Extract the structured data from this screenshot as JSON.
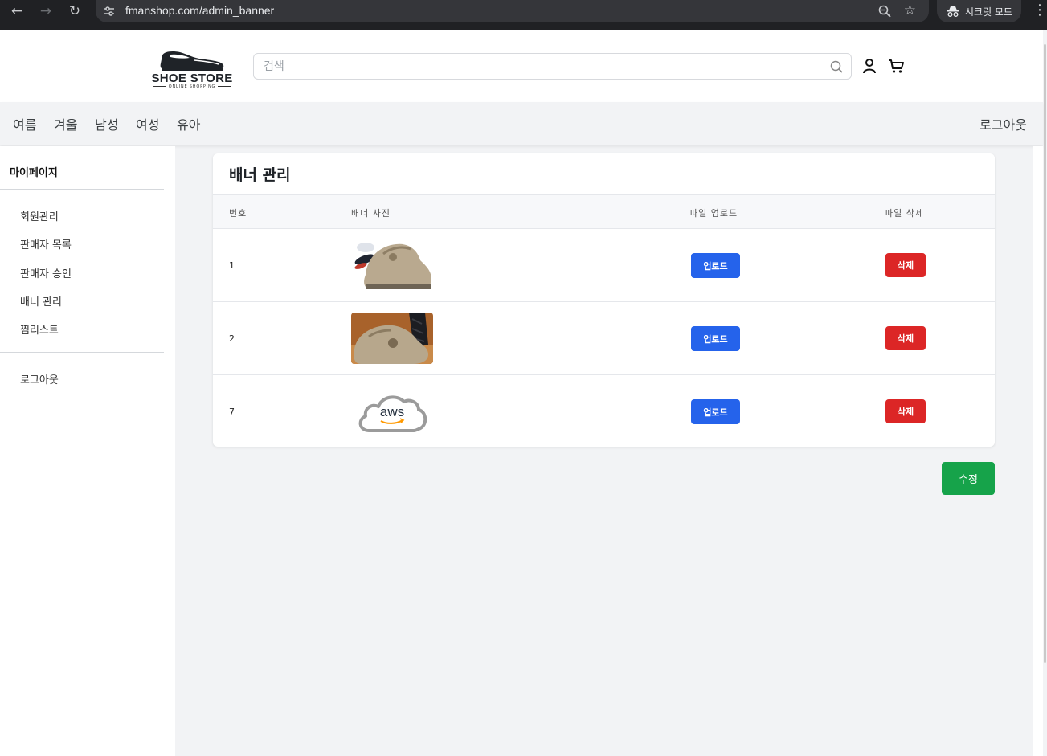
{
  "browser": {
    "url": "fmanshop.com/admin_banner",
    "incognito_label": "시크릿 모드"
  },
  "header": {
    "logo_brand": "SHOE STORE",
    "logo_tagline": "ONLINE SHOPPING",
    "search_placeholder": "검색"
  },
  "categories": [
    "여름",
    "겨울",
    "남성",
    "여성",
    "유아"
  ],
  "topnav_logout": "로그아웃",
  "sidebar": {
    "title": "마이페이지",
    "items": [
      "회원관리",
      "판매자 목록",
      "판매자 승인",
      "배너 관리",
      "찜리스트"
    ],
    "logout": "로그아웃"
  },
  "banner": {
    "title": "배너 관리",
    "columns": [
      "번호",
      "배너 사진",
      "파일 업로드",
      "파일 삭제"
    ],
    "rows": [
      {
        "number": "1",
        "image": "shoe-banner-1",
        "upload_label": "업로드",
        "delete_label": "삭제"
      },
      {
        "number": "2",
        "image": "shoe-banner-2",
        "upload_label": "업로드",
        "delete_label": "삭제"
      },
      {
        "number": "7",
        "image": "aws-logo",
        "upload_label": "업로드",
        "delete_label": "삭제"
      }
    ],
    "aws_text": "aws",
    "save_label": "수정"
  },
  "colors": {
    "upload": "#2563eb",
    "delete": "#dc2626",
    "save": "#16a34a"
  }
}
